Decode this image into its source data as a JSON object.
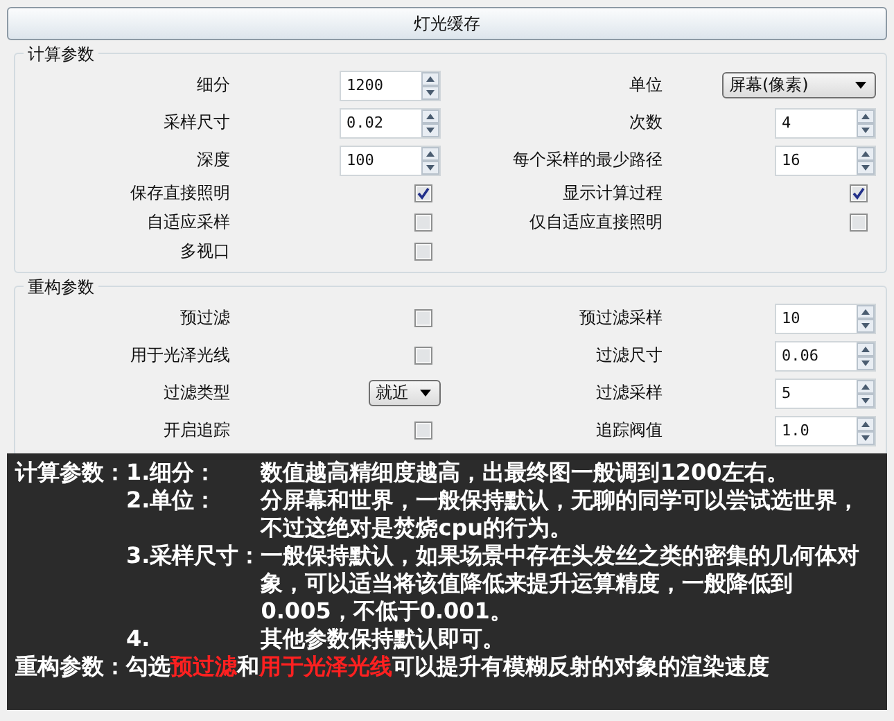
{
  "title": "灯光缓存",
  "groups": [
    {
      "title": "计算参数",
      "rows": [
        {
          "left": {
            "label": "细分",
            "kind": "spinner",
            "value": "1200"
          },
          "right": {
            "label": "单位",
            "kind": "dropdown",
            "value": "屏幕(像素)"
          }
        },
        {
          "left": {
            "label": "采样尺寸",
            "kind": "spinner",
            "value": "0.02"
          },
          "right": {
            "label": "次数",
            "kind": "spinner",
            "value": "4"
          }
        },
        {
          "left": {
            "label": "深度",
            "kind": "spinner",
            "value": "100"
          },
          "right": {
            "label": "每个采样的最少路径",
            "kind": "spinner",
            "value": "16"
          }
        },
        {
          "left": {
            "label": "保存直接照明",
            "kind": "checkbox",
            "checked": true
          },
          "right": {
            "label": "显示计算过程",
            "kind": "checkbox",
            "checked": true
          }
        },
        {
          "left": {
            "label": "自适应采样",
            "kind": "checkbox",
            "checked": false
          },
          "right": {
            "label": "仅自适应直接照明",
            "kind": "checkbox",
            "checked": false
          }
        },
        {
          "left": {
            "label": "多视口",
            "kind": "checkbox",
            "checked": false
          }
        }
      ]
    },
    {
      "title": "重构参数",
      "rows": [
        {
          "left": {
            "label": "预过滤",
            "kind": "checkbox",
            "checked": false
          },
          "right": {
            "label": "预过滤采样",
            "kind": "spinner",
            "value": "10"
          }
        },
        {
          "left": {
            "label": "用于光泽光线",
            "kind": "checkbox",
            "checked": false
          },
          "right": {
            "label": "过滤尺寸",
            "kind": "spinner",
            "value": "0.06"
          }
        },
        {
          "left": {
            "label": "过滤类型",
            "kind": "dropdown",
            "value": "就近"
          },
          "right": {
            "label": "过滤采样",
            "kind": "spinner",
            "value": "5"
          }
        },
        {
          "left": {
            "label": "开启追踪",
            "kind": "checkbox",
            "checked": false
          },
          "right": {
            "label": "追踪阀值",
            "kind": "spinner",
            "value": "1.0"
          }
        }
      ]
    }
  ],
  "notes": [
    {
      "kind": "list",
      "heading": "计算参数：",
      "items": [
        {
          "number": "1.细分：",
          "text": "数值越高精细度越高，出最终图一般调到1200左右。"
        },
        {
          "number": "2.单位：",
          "text": "分屏幕和世界，一般保持默认，无聊的同学可以尝试选世界，不过这绝对是焚烧cpu的行为。"
        },
        {
          "number": "3.采样尺寸：",
          "text": "一般保持默认，如果场景中存在头发丝之类的密集的几何体对象，可以适当将该值降低来提升运算精度，一般降低到0.005，不低于0.001。"
        },
        {
          "number": "4.",
          "text": "其他参数保持默认即可。"
        }
      ]
    },
    {
      "kind": "sentence",
      "heading": "重构参数：",
      "parts": [
        {
          "text": "勾选",
          "highlight": false
        },
        {
          "text": "预过滤",
          "highlight": true
        },
        {
          "text": "和",
          "highlight": false
        },
        {
          "text": "用于光泽光线",
          "highlight": true
        },
        {
          "text": "可以提升有模糊反射的对象的渲染速度",
          "highlight": false
        }
      ]
    }
  ]
}
